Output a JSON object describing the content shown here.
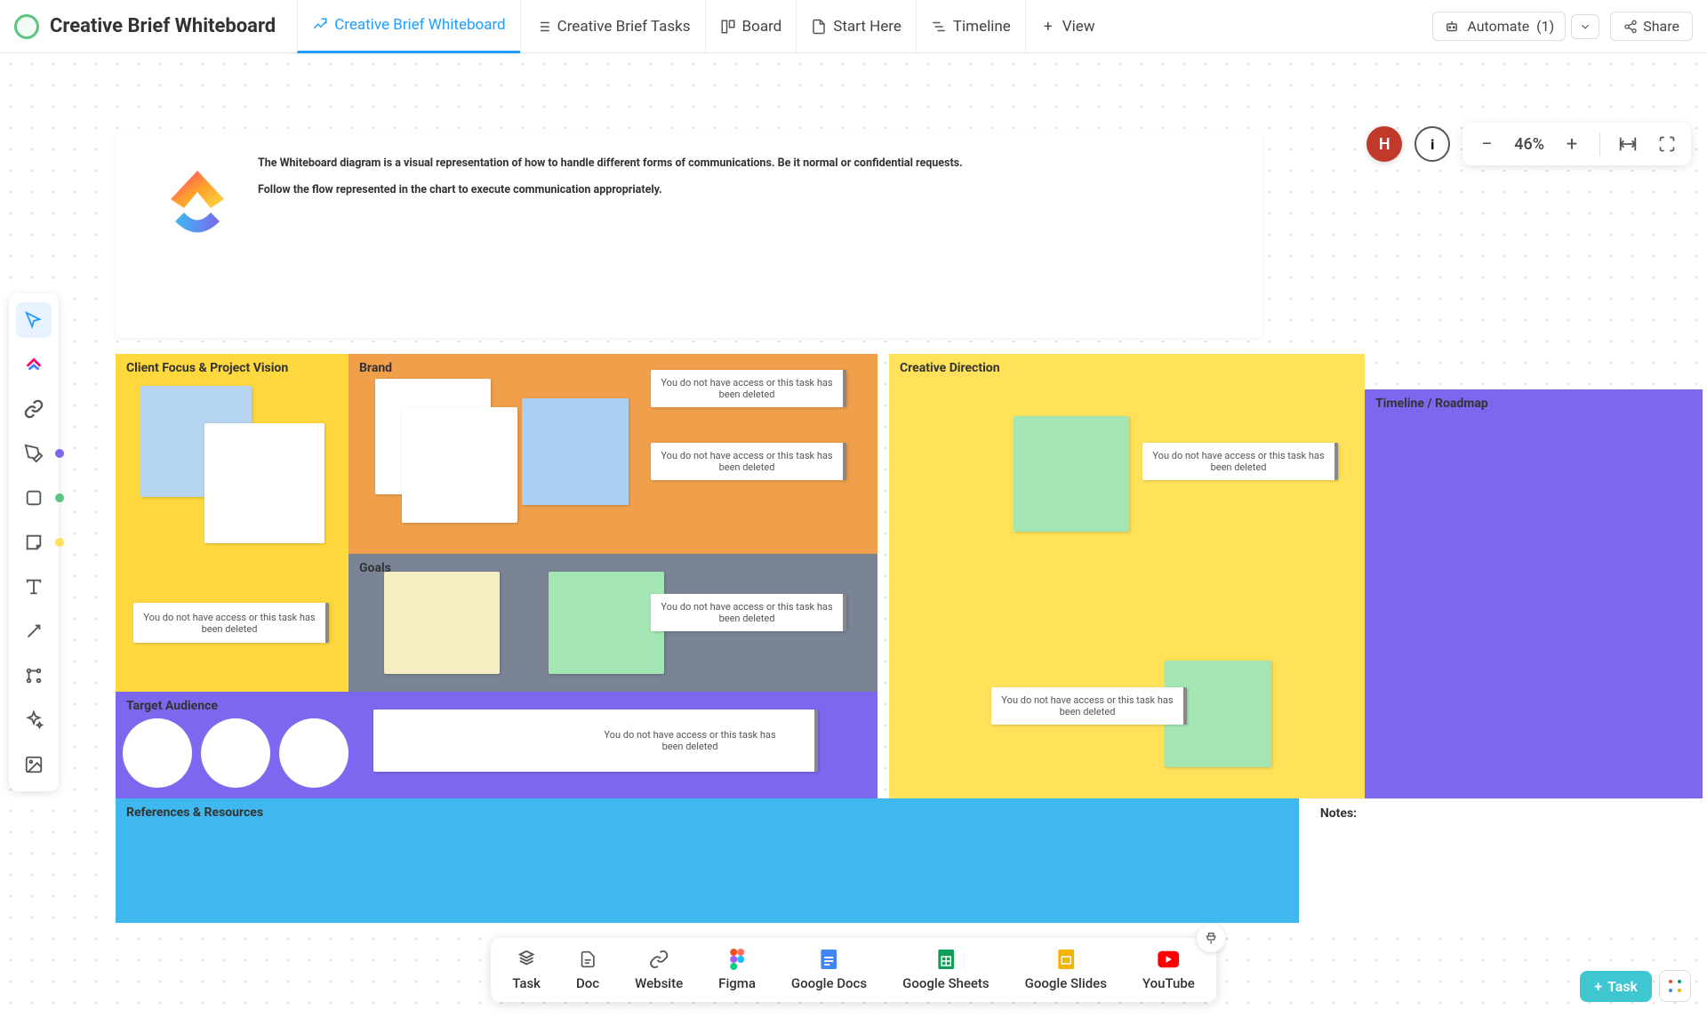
{
  "header": {
    "title": "Creative Brief Whiteboard",
    "tabs": [
      {
        "label": "Creative Brief Whiteboard",
        "icon": "whiteboard-icon",
        "active": true
      },
      {
        "label": "Creative Brief Tasks",
        "icon": "list-icon"
      },
      {
        "label": "Board",
        "icon": "board-icon"
      },
      {
        "label": "Start Here",
        "icon": "doc-icon"
      },
      {
        "label": "Timeline",
        "icon": "timeline-icon"
      },
      {
        "label": "View",
        "icon": "plus-icon"
      }
    ],
    "automate": {
      "label": "Automate",
      "count": "(1)"
    },
    "share": "Share"
  },
  "controls": {
    "avatar": "H",
    "zoom": "46%"
  },
  "intro": {
    "line1": "The Whiteboard diagram is a visual representation of how to handle different forms of communications. Be it normal or confidential requests.",
    "line2": "Follow the flow represented in the chart to execute communication appropriately."
  },
  "sections": {
    "client": "Client Focus & Project Vision",
    "brand": "Brand",
    "goals": "Goals",
    "creative": "Creative Direction",
    "timeline": "Timeline / Roadmap",
    "target": "Target Audience",
    "refs": "References & Resources",
    "notes": "Notes:"
  },
  "messages": {
    "no_access": "You do not have access or this task has been deleted"
  },
  "bottom_bar": [
    {
      "label": "Task",
      "color": "#555"
    },
    {
      "label": "Doc",
      "color": "#555"
    },
    {
      "label": "Website",
      "color": "#555"
    },
    {
      "label": "Figma",
      "color": "#f24e1e"
    },
    {
      "label": "Google Docs",
      "color": "#4285f4"
    },
    {
      "label": "Google Sheets",
      "color": "#0f9d58"
    },
    {
      "label": "Google Slides",
      "color": "#f4b400"
    },
    {
      "label": "YouTube",
      "color": "#ff0000"
    }
  ],
  "task_button": "Task"
}
